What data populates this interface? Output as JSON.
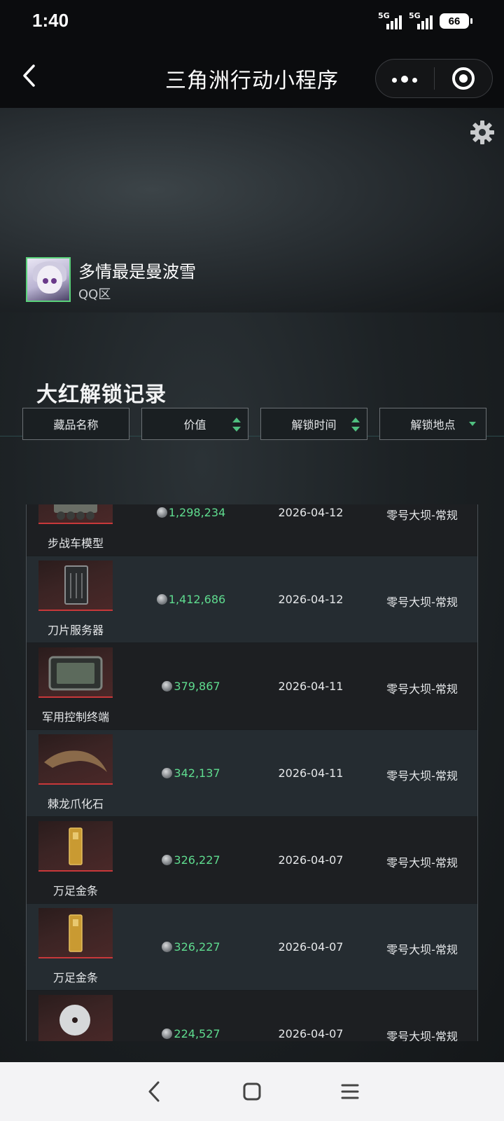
{
  "status_bar": {
    "time": "1:40",
    "network1": "5G",
    "network2": "5G",
    "battery": "66"
  },
  "title_bar": {
    "title": "三角洲行动小程序"
  },
  "profile": {
    "username": "多情最是曼波雪",
    "region": "QQ区"
  },
  "section": {
    "title": "大红解锁记录"
  },
  "filters": [
    {
      "label": "藏品名称",
      "control": "none"
    },
    {
      "label": "价值",
      "control": "sort"
    },
    {
      "label": "解锁时间",
      "control": "sort"
    },
    {
      "label": "解锁地点",
      "control": "dropdown"
    }
  ],
  "records": [
    {
      "name": "步战车模型",
      "value": "1,298,234",
      "date": "2026-04-12",
      "location": "零号大坝-常规",
      "icon": "ifv-model-icon"
    },
    {
      "name": "刀片服务器",
      "value": "1,412,686",
      "date": "2026-04-12",
      "location": "零号大坝-常规",
      "icon": "blade-server-icon"
    },
    {
      "name": "军用控制终端",
      "value": "379,867",
      "date": "2026-04-11",
      "location": "零号大坝-常规",
      "icon": "control-terminal-icon"
    },
    {
      "name": "棘龙爪化石",
      "value": "342,137",
      "date": "2026-04-11",
      "location": "零号大坝-常规",
      "icon": "claw-fossil-icon"
    },
    {
      "name": "万足金条",
      "value": "326,227",
      "date": "2026-04-07",
      "location": "零号大坝-常规",
      "icon": "gold-bar-icon"
    },
    {
      "name": "万足金条",
      "value": "326,227",
      "date": "2026-04-07",
      "location": "零号大坝-常规",
      "icon": "gold-bar-icon"
    },
    {
      "name": "",
      "value": "224,527",
      "date": "2026-04-07",
      "location": "零号大坝-常规",
      "icon": "disc-icon"
    }
  ],
  "colors": {
    "value_green": "#5fdc8f",
    "accent_green": "#4fbf7f",
    "thumb_border_red": "#c8383a"
  }
}
